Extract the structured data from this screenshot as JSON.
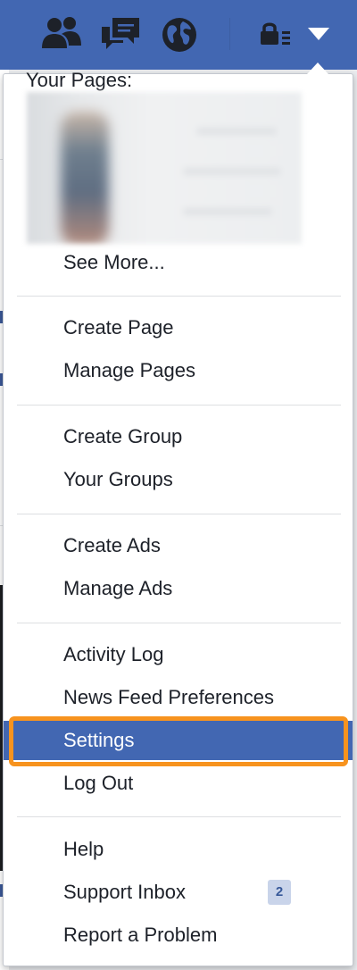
{
  "topbar": {
    "icons": [
      "friends-icon",
      "messages-icon",
      "globe-icon",
      "privacy-shortcuts-icon",
      "account-dropdown-icon"
    ]
  },
  "menu": {
    "your_pages_label": "Your Pages:",
    "see_more": "See More...",
    "pages": {
      "create": "Create Page",
      "manage": "Manage Pages"
    },
    "groups": {
      "create": "Create Group",
      "yours": "Your Groups"
    },
    "ads": {
      "create": "Create Ads",
      "manage": "Manage Ads"
    },
    "account": {
      "activity_log": "Activity Log",
      "news_feed_prefs": "News Feed Preferences",
      "settings": "Settings",
      "log_out": "Log Out"
    },
    "support": {
      "help": "Help",
      "inbox": "Support Inbox",
      "inbox_count": "2",
      "report": "Report a Problem"
    }
  },
  "colors": {
    "brand_blue": "#4267b2",
    "highlight_orange": "#f7931e",
    "badge_bg": "#c9d4ea"
  }
}
